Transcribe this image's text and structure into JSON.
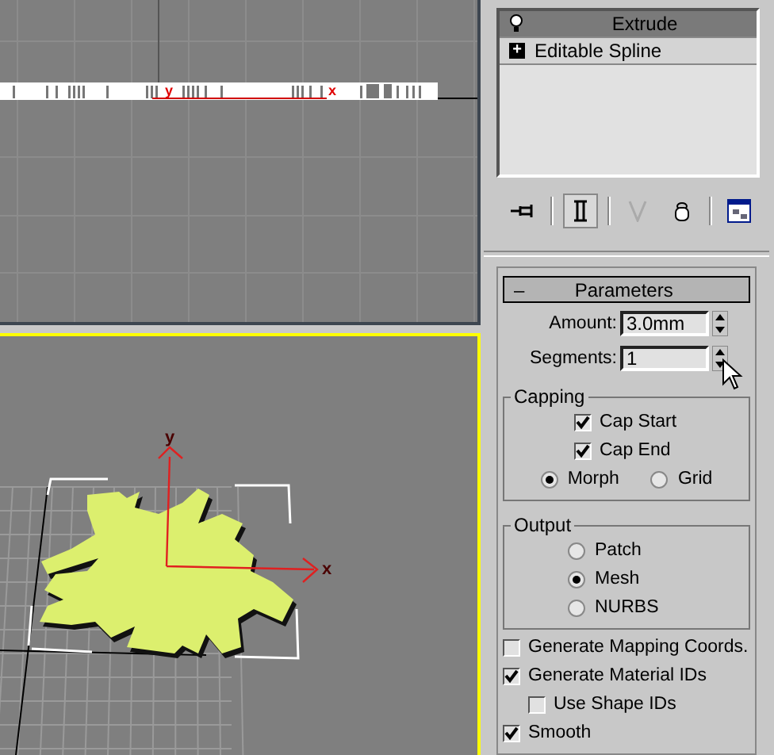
{
  "viewports": [
    {
      "kind": "front",
      "active": false,
      "axis_labels": [
        "y",
        "x"
      ]
    },
    {
      "kind": "perspective",
      "active": true,
      "axis_labels": [
        "y",
        "x"
      ]
    }
  ],
  "modifier_stack": {
    "items": [
      {
        "label": "Extrude",
        "selected": true,
        "kind": "modifier"
      },
      {
        "label": "Editable Spline",
        "selected": false,
        "kind": "base",
        "expand_sign": "+"
      }
    ]
  },
  "stack_toolbar": [
    {
      "kind": "pin",
      "pressed": false
    },
    {
      "kind": "show-end-result",
      "pressed": true
    },
    {
      "kind": "make-unique",
      "pressed": false
    },
    {
      "kind": "remove",
      "pressed": false
    },
    {
      "kind": "configure",
      "pressed": false
    }
  ],
  "parameters": {
    "title": "Parameters",
    "collapse_sign": "–",
    "spinners": [
      {
        "label": "Amount:",
        "value": "3.0mm"
      },
      {
        "label": "Segments:",
        "value": "1"
      }
    ],
    "capping": {
      "title": "Capping",
      "checks": [
        {
          "label": "Cap Start",
          "checked": true
        },
        {
          "label": "Cap End",
          "checked": true
        }
      ],
      "options": [
        {
          "label": "Morph",
          "selected": true
        },
        {
          "label": "Grid",
          "selected": false
        }
      ]
    },
    "output": {
      "title": "Output",
      "options": [
        {
          "label": "Patch",
          "selected": false
        },
        {
          "label": "Mesh",
          "selected": true
        },
        {
          "label": "NURBS",
          "selected": false
        }
      ]
    },
    "checks": [
      {
        "label": "Generate Mapping Coords.",
        "checked": false
      },
      {
        "label": "Generate Material IDs",
        "checked": true,
        "children": [
          {
            "label": "Use Shape IDs",
            "checked": false
          }
        ]
      },
      {
        "label": "Smooth",
        "checked": true
      }
    ]
  }
}
